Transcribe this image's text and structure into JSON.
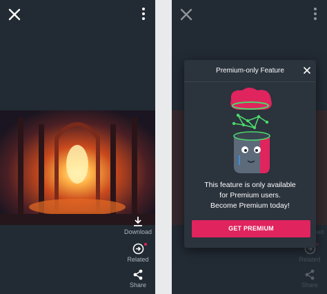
{
  "left_panel": {
    "actions": [
      {
        "label": "Download",
        "icon": "download-icon"
      },
      {
        "label": "Related",
        "icon": "related-icon"
      },
      {
        "label": "Share",
        "icon": "share-icon"
      }
    ]
  },
  "right_panel": {
    "actions": [
      {
        "label": "Download",
        "icon": "download-icon"
      },
      {
        "label": "Related",
        "icon": "related-icon"
      },
      {
        "label": "Share",
        "icon": "share-icon"
      }
    ]
  },
  "modal": {
    "title": "Premium-only Feature",
    "message_lines": [
      "This feature is only available",
      "for Premium users.",
      "Become Premium today!"
    ],
    "cta_label": "GET PREMIUM"
  },
  "colors": {
    "panel_bg": "#222a33",
    "modal_bg": "#2b333d",
    "accent": "#e0245e",
    "muted_text": "#aeb6bf"
  }
}
